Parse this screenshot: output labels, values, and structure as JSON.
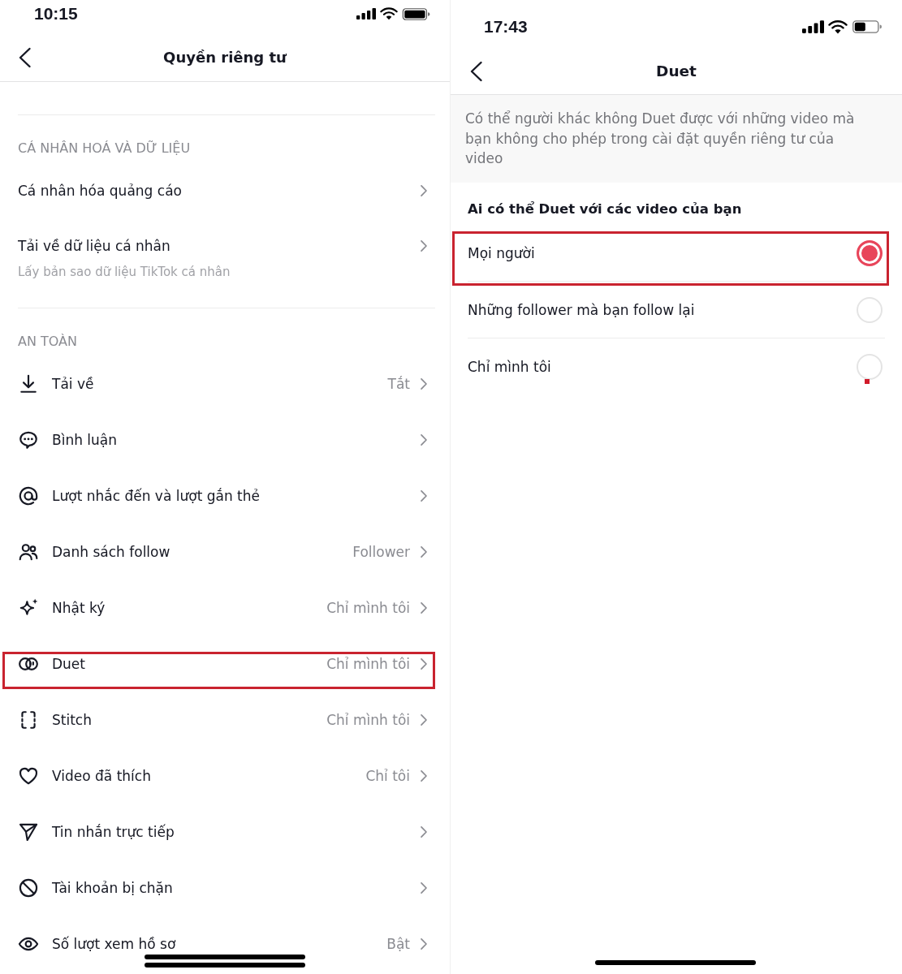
{
  "privacy_screen": {
    "status_bar": {
      "time": "10:15"
    },
    "header": {
      "title": "Quyền riêng tư"
    },
    "sections": [
      {
        "heading": "CÁ NHÂN HOÁ VÀ DỮ LIỆU",
        "rows": [
          {
            "label": "Cá nhân hóa quảng cáo",
            "highlighted": false
          },
          {
            "label": "Tải về dữ liệu cá nhân",
            "subtitle": "Lấy bản sao dữ liệu TikTok cá nhân",
            "highlighted": false
          }
        ]
      },
      {
        "heading": "AN TOÀN",
        "rows": [
          {
            "label": "Tải về",
            "value": "Tắt",
            "highlighted": false
          },
          {
            "label": "Bình luận",
            "highlighted": false
          },
          {
            "label": "Lượt nhắc đến và lượt gắn thẻ",
            "highlighted": false
          },
          {
            "label": "Danh sách follow",
            "value": "Follower",
            "highlighted": false
          },
          {
            "label": "Nhật ký",
            "value": "Chỉ mình tôi",
            "highlighted": false
          },
          {
            "label": "Duet",
            "value": "Chỉ mình tôi",
            "highlighted": true
          },
          {
            "label": "Stitch",
            "value": "Chỉ mình tôi",
            "highlighted": false
          },
          {
            "label": "Video đã thích",
            "value": "Chỉ tôi",
            "highlighted": false
          },
          {
            "label": "Tin nhắn trực tiếp",
            "highlighted": false
          },
          {
            "label": "Tài khoản bị chặn",
            "highlighted": false
          },
          {
            "label": "Số lượt xem hồ sơ",
            "value": "Bật",
            "highlighted": false
          }
        ]
      }
    ]
  },
  "duet_screen": {
    "status_bar": {
      "time": "17:43"
    },
    "header": {
      "title": "Duet"
    },
    "notice": "Có thể người khác không Duet được với những video mà bạn không cho phép trong cài đặt quyền riêng tư của video",
    "question": "Ai có thể Duet với các video của bạn",
    "options": [
      {
        "label": "Mọi người",
        "selected": true,
        "highlighted": true
      },
      {
        "label": "Những follower mà bạn follow lại",
        "selected": false,
        "highlighted": false
      },
      {
        "label": "Chỉ mình tôi",
        "selected": false,
        "highlighted": false
      }
    ]
  }
}
